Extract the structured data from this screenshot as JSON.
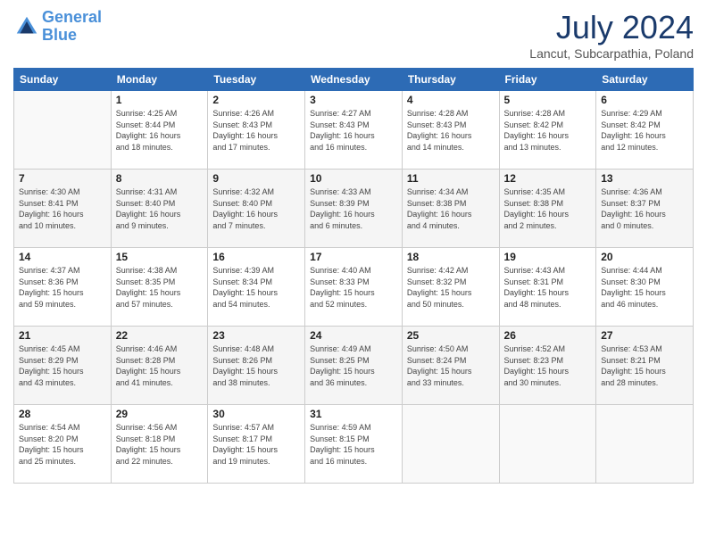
{
  "logo": {
    "line1": "General",
    "line2": "Blue"
  },
  "title": "July 2024",
  "subtitle": "Lancut, Subcarpathia, Poland",
  "headers": [
    "Sunday",
    "Monday",
    "Tuesday",
    "Wednesday",
    "Thursday",
    "Friday",
    "Saturday"
  ],
  "weeks": [
    [
      {
        "num": "",
        "info": ""
      },
      {
        "num": "1",
        "info": "Sunrise: 4:25 AM\nSunset: 8:44 PM\nDaylight: 16 hours\nand 18 minutes."
      },
      {
        "num": "2",
        "info": "Sunrise: 4:26 AM\nSunset: 8:43 PM\nDaylight: 16 hours\nand 17 minutes."
      },
      {
        "num": "3",
        "info": "Sunrise: 4:27 AM\nSunset: 8:43 PM\nDaylight: 16 hours\nand 16 minutes."
      },
      {
        "num": "4",
        "info": "Sunrise: 4:28 AM\nSunset: 8:43 PM\nDaylight: 16 hours\nand 14 minutes."
      },
      {
        "num": "5",
        "info": "Sunrise: 4:28 AM\nSunset: 8:42 PM\nDaylight: 16 hours\nand 13 minutes."
      },
      {
        "num": "6",
        "info": "Sunrise: 4:29 AM\nSunset: 8:42 PM\nDaylight: 16 hours\nand 12 minutes."
      }
    ],
    [
      {
        "num": "7",
        "info": "Sunrise: 4:30 AM\nSunset: 8:41 PM\nDaylight: 16 hours\nand 10 minutes."
      },
      {
        "num": "8",
        "info": "Sunrise: 4:31 AM\nSunset: 8:40 PM\nDaylight: 16 hours\nand 9 minutes."
      },
      {
        "num": "9",
        "info": "Sunrise: 4:32 AM\nSunset: 8:40 PM\nDaylight: 16 hours\nand 7 minutes."
      },
      {
        "num": "10",
        "info": "Sunrise: 4:33 AM\nSunset: 8:39 PM\nDaylight: 16 hours\nand 6 minutes."
      },
      {
        "num": "11",
        "info": "Sunrise: 4:34 AM\nSunset: 8:38 PM\nDaylight: 16 hours\nand 4 minutes."
      },
      {
        "num": "12",
        "info": "Sunrise: 4:35 AM\nSunset: 8:38 PM\nDaylight: 16 hours\nand 2 minutes."
      },
      {
        "num": "13",
        "info": "Sunrise: 4:36 AM\nSunset: 8:37 PM\nDaylight: 16 hours\nand 0 minutes."
      }
    ],
    [
      {
        "num": "14",
        "info": "Sunrise: 4:37 AM\nSunset: 8:36 PM\nDaylight: 15 hours\nand 59 minutes."
      },
      {
        "num": "15",
        "info": "Sunrise: 4:38 AM\nSunset: 8:35 PM\nDaylight: 15 hours\nand 57 minutes."
      },
      {
        "num": "16",
        "info": "Sunrise: 4:39 AM\nSunset: 8:34 PM\nDaylight: 15 hours\nand 54 minutes."
      },
      {
        "num": "17",
        "info": "Sunrise: 4:40 AM\nSunset: 8:33 PM\nDaylight: 15 hours\nand 52 minutes."
      },
      {
        "num": "18",
        "info": "Sunrise: 4:42 AM\nSunset: 8:32 PM\nDaylight: 15 hours\nand 50 minutes."
      },
      {
        "num": "19",
        "info": "Sunrise: 4:43 AM\nSunset: 8:31 PM\nDaylight: 15 hours\nand 48 minutes."
      },
      {
        "num": "20",
        "info": "Sunrise: 4:44 AM\nSunset: 8:30 PM\nDaylight: 15 hours\nand 46 minutes."
      }
    ],
    [
      {
        "num": "21",
        "info": "Sunrise: 4:45 AM\nSunset: 8:29 PM\nDaylight: 15 hours\nand 43 minutes."
      },
      {
        "num": "22",
        "info": "Sunrise: 4:46 AM\nSunset: 8:28 PM\nDaylight: 15 hours\nand 41 minutes."
      },
      {
        "num": "23",
        "info": "Sunrise: 4:48 AM\nSunset: 8:26 PM\nDaylight: 15 hours\nand 38 minutes."
      },
      {
        "num": "24",
        "info": "Sunrise: 4:49 AM\nSunset: 8:25 PM\nDaylight: 15 hours\nand 36 minutes."
      },
      {
        "num": "25",
        "info": "Sunrise: 4:50 AM\nSunset: 8:24 PM\nDaylight: 15 hours\nand 33 minutes."
      },
      {
        "num": "26",
        "info": "Sunrise: 4:52 AM\nSunset: 8:23 PM\nDaylight: 15 hours\nand 30 minutes."
      },
      {
        "num": "27",
        "info": "Sunrise: 4:53 AM\nSunset: 8:21 PM\nDaylight: 15 hours\nand 28 minutes."
      }
    ],
    [
      {
        "num": "28",
        "info": "Sunrise: 4:54 AM\nSunset: 8:20 PM\nDaylight: 15 hours\nand 25 minutes."
      },
      {
        "num": "29",
        "info": "Sunrise: 4:56 AM\nSunset: 8:18 PM\nDaylight: 15 hours\nand 22 minutes."
      },
      {
        "num": "30",
        "info": "Sunrise: 4:57 AM\nSunset: 8:17 PM\nDaylight: 15 hours\nand 19 minutes."
      },
      {
        "num": "31",
        "info": "Sunrise: 4:59 AM\nSunset: 8:15 PM\nDaylight: 15 hours\nand 16 minutes."
      },
      {
        "num": "",
        "info": ""
      },
      {
        "num": "",
        "info": ""
      },
      {
        "num": "",
        "info": ""
      }
    ]
  ]
}
